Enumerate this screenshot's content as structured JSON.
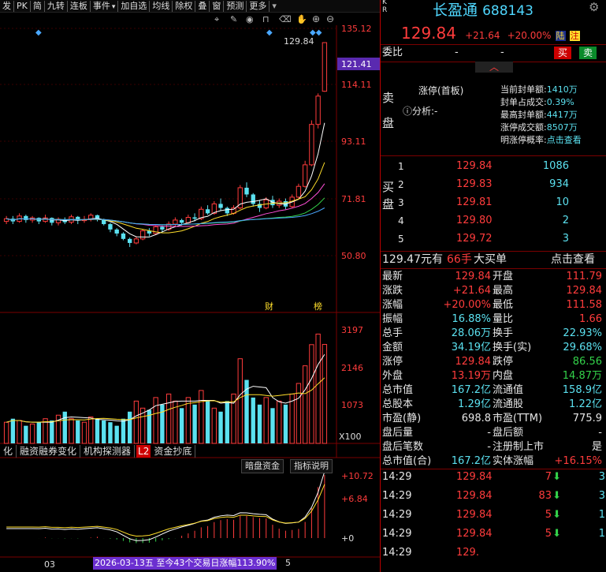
{
  "toolbar": {
    "items": [
      "发",
      "PK",
      "简",
      "九转",
      "连板",
      "事件",
      "加自选",
      "均线",
      "除权",
      "叠",
      "窗",
      "预测",
      "更多"
    ],
    "icons": [
      "crosshair-icon",
      "pencil-icon",
      "eye-icon",
      "lock-icon",
      "trash-icon",
      "hand-icon",
      "zoom-in-icon",
      "zoom-out-icon"
    ]
  },
  "chart": {
    "price_ticks": [
      "135.12",
      "114.11",
      "93.11",
      "71.81",
      "50.80"
    ],
    "current_price_tag": "121.41",
    "high_label": "129.84",
    "markers": {
      "cai": "财",
      "bang": "榜"
    },
    "volume_ticks": [
      "3197",
      "2146",
      "1073"
    ],
    "volume_unit": "X100",
    "indicator_tabs": [
      "化",
      "融资融券变化",
      "机构探测器",
      "L2",
      "资金抄底"
    ],
    "indicator_buttons": [
      "暗盘资金",
      "指标说明"
    ],
    "indicator_ticks": [
      "+10.72",
      "+6.84",
      "+0"
    ],
    "date_label": "03",
    "range_note": "2026-03-13五 至今43个交易日涨幅113.90%",
    "range_note_suffix": "5"
  },
  "chart_data": {
    "type": "candlestick",
    "price_ylim": [
      50.8,
      135.12
    ],
    "candles": [
      {
        "o": 63.5,
        "c": 64.5,
        "h": 65.5,
        "l": 62.5
      },
      {
        "o": 64.5,
        "c": 63.5,
        "h": 65.5,
        "l": 62.5
      },
      {
        "o": 63.5,
        "c": 65.5,
        "h": 66.5,
        "l": 63.0
      },
      {
        "o": 65.5,
        "c": 64.0,
        "h": 66.0,
        "l": 63.0
      },
      {
        "o": 64.0,
        "c": 64.8,
        "h": 65.5,
        "l": 63.0
      },
      {
        "o": 64.8,
        "c": 63.5,
        "h": 65.0,
        "l": 62.5
      },
      {
        "o": 63.5,
        "c": 64.8,
        "h": 66.0,
        "l": 63.0
      },
      {
        "o": 64.8,
        "c": 63.0,
        "h": 65.0,
        "l": 62.0
      },
      {
        "o": 63.0,
        "c": 64.3,
        "h": 65.0,
        "l": 62.0
      },
      {
        "o": 64.3,
        "c": 63.2,
        "h": 65.0,
        "l": 62.5
      },
      {
        "o": 63.2,
        "c": 65.2,
        "h": 66.0,
        "l": 62.5
      },
      {
        "o": 65.2,
        "c": 63.8,
        "h": 65.5,
        "l": 62.5
      },
      {
        "o": 63.8,
        "c": 64.2,
        "h": 65.5,
        "l": 63.0
      },
      {
        "o": 64.2,
        "c": 65.8,
        "h": 66.5,
        "l": 63.5
      },
      {
        "o": 65.8,
        "c": 64.3,
        "h": 66.0,
        "l": 63.5
      },
      {
        "o": 64.3,
        "c": 62.5,
        "h": 64.5,
        "l": 62.0
      },
      {
        "o": 62.5,
        "c": 60.5,
        "h": 63.0,
        "l": 59.5
      },
      {
        "o": 60.5,
        "c": 59.0,
        "h": 61.0,
        "l": 58.0
      },
      {
        "o": 59.0,
        "c": 57.0,
        "h": 59.5,
        "l": 56.5
      },
      {
        "o": 57.0,
        "c": 55.5,
        "h": 57.5,
        "l": 54.0
      },
      {
        "o": 55.5,
        "c": 57.0,
        "h": 58.0,
        "l": 55.0
      },
      {
        "o": 57.0,
        "c": 60.0,
        "h": 60.5,
        "l": 56.5
      },
      {
        "o": 60.0,
        "c": 59.0,
        "h": 61.0,
        "l": 58.0
      },
      {
        "o": 59.0,
        "c": 61.5,
        "h": 62.0,
        "l": 58.5
      },
      {
        "o": 61.5,
        "c": 60.5,
        "h": 62.0,
        "l": 59.5
      },
      {
        "o": 60.5,
        "c": 62.5,
        "h": 63.5,
        "l": 60.0
      },
      {
        "o": 62.5,
        "c": 64.0,
        "h": 65.0,
        "l": 61.5
      },
      {
        "o": 64.0,
        "c": 63.0,
        "h": 64.5,
        "l": 62.0
      },
      {
        "o": 63.0,
        "c": 65.0,
        "h": 66.0,
        "l": 62.5
      },
      {
        "o": 65.0,
        "c": 64.5,
        "h": 66.5,
        "l": 63.5
      },
      {
        "o": 64.5,
        "c": 68.0,
        "h": 69.0,
        "l": 64.0
      },
      {
        "o": 68.0,
        "c": 66.5,
        "h": 69.5,
        "l": 66.0
      },
      {
        "o": 66.5,
        "c": 70.0,
        "h": 71.0,
        "l": 66.0
      },
      {
        "o": 70.0,
        "c": 68.5,
        "h": 72.0,
        "l": 67.5
      },
      {
        "o": 68.5,
        "c": 66.5,
        "h": 69.0,
        "l": 65.5
      },
      {
        "o": 66.5,
        "c": 68.5,
        "h": 69.5,
        "l": 66.0
      },
      {
        "o": 68.5,
        "c": 76.0,
        "h": 77.0,
        "l": 68.0
      },
      {
        "o": 76.0,
        "c": 73.5,
        "h": 78.0,
        "l": 72.5
      },
      {
        "o": 73.5,
        "c": 70.0,
        "h": 74.0,
        "l": 69.0
      },
      {
        "o": 70.0,
        "c": 68.5,
        "h": 71.5,
        "l": 67.0
      },
      {
        "o": 68.5,
        "c": 71.5,
        "h": 72.5,
        "l": 68.0
      },
      {
        "o": 71.5,
        "c": 69.5,
        "h": 73.0,
        "l": 68.5
      },
      {
        "o": 69.5,
        "c": 71.0,
        "h": 72.0,
        "l": 68.5
      },
      {
        "o": 71.0,
        "c": 69.0,
        "h": 72.0,
        "l": 68.0
      },
      {
        "o": 69.0,
        "c": 72.5,
        "h": 73.5,
        "l": 68.5
      },
      {
        "o": 72.5,
        "c": 76.5,
        "h": 77.5,
        "l": 72.0
      },
      {
        "o": 76.5,
        "c": 84.5,
        "h": 86.0,
        "l": 76.0
      },
      {
        "o": 84.5,
        "c": 99.5,
        "h": 101.0,
        "l": 84.0
      },
      {
        "o": 99.5,
        "c": 110.0,
        "h": 111.0,
        "l": 98.0
      },
      {
        "o": 111.8,
        "c": 129.84,
        "h": 129.84,
        "l": 111.58
      }
    ],
    "volume_ylim": [
      0,
      3400
    ],
    "volume": [
      600,
      700,
      650,
      500,
      550,
      600,
      700,
      650,
      800,
      900,
      700,
      650,
      600,
      750,
      700,
      650,
      600,
      500,
      700,
      900,
      1200,
      1000,
      950,
      1300,
      1100,
      1400,
      1200,
      1000,
      1300,
      1100,
      1500,
      1200,
      1000,
      900,
      1200,
      1400,
      2400,
      1800,
      1300,
      1100,
      1300,
      1000,
      1200,
      1100,
      1400,
      1700,
      2200,
      2800,
      3100,
      2806
    ]
  },
  "stock": {
    "flags": [
      "K",
      "R"
    ],
    "name": "长盈通",
    "code": "688143",
    "price": "129.84",
    "change": "+21.64",
    "change_pct": "+20.00%",
    "tag_lu": "陆",
    "tag_zhu": "注"
  },
  "order": {
    "weibi_label": "委比",
    "weibi_val1": "-",
    "weibi_val2": "-",
    "buy_btn": "买",
    "sell_btn": "卖",
    "sell_side": "卖盘",
    "limit_title": "涨停(首板)",
    "analysis": "分析:-",
    "stats": [
      {
        "k": "当前封单额:",
        "v": "1410万"
      },
      {
        "k": "封单占成交:",
        "v": "0.39%"
      },
      {
        "k": "最高封单额:",
        "v": "4417万"
      },
      {
        "k": "涨停成交额:",
        "v": "8507万"
      },
      {
        "k": "明涨停概率:",
        "v": "点击查看"
      }
    ],
    "buy_side": "买盘",
    "bids": [
      {
        "lvl": "1",
        "price": "129.84",
        "vol": "1086"
      },
      {
        "lvl": "2",
        "price": "129.83",
        "vol": "934"
      },
      {
        "lvl": "3",
        "price": "129.81",
        "vol": "10"
      },
      {
        "lvl": "4",
        "price": "129.80",
        "vol": "2"
      },
      {
        "lvl": "5",
        "price": "129.72",
        "vol": "3"
      }
    ],
    "big_buy": {
      "price": "129.47元有",
      "qty": "66手",
      "label": "大买单",
      "link": "点击查看"
    }
  },
  "quote": [
    {
      "k1": "最新",
      "v1": "129.84",
      "c1": "red",
      "k2": "开盘",
      "v2": "111.79",
      "c2": "red"
    },
    {
      "k1": "涨跌",
      "v1": "+21.64",
      "c1": "red",
      "k2": "最高",
      "v2": "129.84",
      "c2": "red"
    },
    {
      "k1": "涨幅",
      "v1": "+20.00%",
      "c1": "red",
      "k2": "最低",
      "v2": "111.58",
      "c2": "red"
    },
    {
      "k1": "振幅",
      "v1": "16.88%",
      "c1": "cyan",
      "k2": "量比",
      "v2": "1.66",
      "c2": "red"
    },
    {
      "k1": "总手",
      "v1": "28.06万",
      "c1": "cyan",
      "k2": "换手",
      "v2": "22.93%",
      "c2": "cyan"
    },
    {
      "k1": "金额",
      "v1": "34.19亿",
      "c1": "cyan",
      "k2": "换手(实)",
      "v2": "29.68%",
      "c2": "cyan"
    },
    {
      "k1": "涨停",
      "v1": "129.84",
      "c1": "red",
      "k2": "跌停",
      "v2": "86.56",
      "c2": "green"
    },
    {
      "k1": "外盘",
      "v1": "13.19万",
      "c1": "red",
      "k2": "内盘",
      "v2": "14.87万",
      "c2": "green"
    },
    {
      "k1": "总市值",
      "v1": "167.2亿",
      "c1": "cyan",
      "k2": "流通值",
      "v2": "158.9亿",
      "c2": "cyan"
    },
    {
      "k1": "总股本",
      "v1": "1.29亿",
      "c1": "cyan",
      "k2": "流通股",
      "v2": "1.22亿",
      "c2": "cyan"
    },
    {
      "k1": "市盈(静)",
      "v1": "698.8",
      "c1": "white",
      "k2": "市盈(TTM)",
      "v2": "775.9",
      "c2": "white"
    },
    {
      "k1": "盘后量",
      "v1": "-",
      "c1": "white",
      "k2": "盘后额",
      "v2": "-",
      "c2": "white"
    },
    {
      "k1": "盘后笔数",
      "v1": "-",
      "c1": "white",
      "k2": "注册制上市",
      "v2": "是",
      "c2": "white"
    },
    {
      "k1": "总市值(合)",
      "v1": "167.2亿",
      "c1": "cyan",
      "k2": "实体涨幅",
      "v2": "+16.15%",
      "c2": "red"
    }
  ],
  "ticks": [
    {
      "time": "14:29",
      "price": "129.84",
      "vol": "7",
      "extra": "3"
    },
    {
      "time": "14:29",
      "price": "129.84",
      "vol": "83",
      "extra": "3"
    },
    {
      "time": "14:29",
      "price": "129.84",
      "vol": "5",
      "extra": "1"
    },
    {
      "time": "14:29",
      "price": "129.84",
      "vol": "5",
      "extra": "1"
    },
    {
      "time": "14:29",
      "price": "129.",
      "vol": "",
      "extra": ""
    }
  ],
  "colors": {
    "up": "#ff3c3c",
    "down": "#5be1f0",
    "accent_green": "#33d24a",
    "tag_bg": "#7a3cff"
  }
}
